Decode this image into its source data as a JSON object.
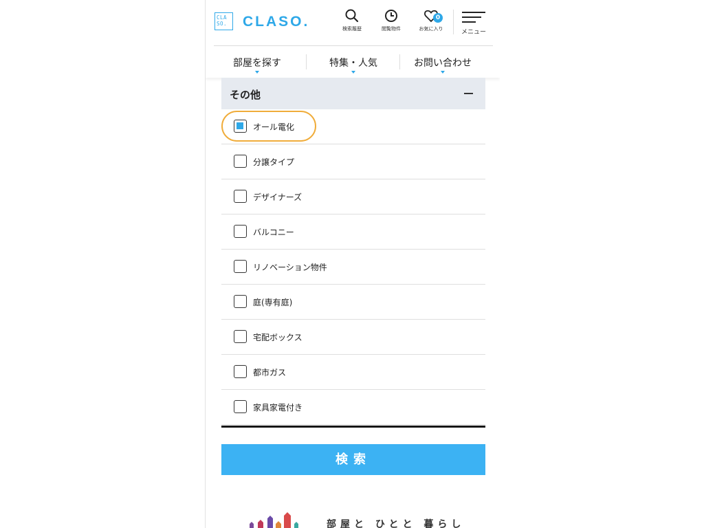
{
  "header": {
    "logo_mark_top": "CLA",
    "logo_mark_bottom": "SO.",
    "logo_text": "CLASO.",
    "icons": [
      {
        "name": "search-icon",
        "label": "検索履歴"
      },
      {
        "name": "history-icon",
        "label": "閲覧物件"
      },
      {
        "name": "heart-icon",
        "label": "お気に入り",
        "badge": "0"
      },
      {
        "name": "menu-icon",
        "label": "メニュー"
      }
    ]
  },
  "nav": {
    "items": [
      "部屋を探す",
      "特集・人気",
      "お問い合わせ"
    ]
  },
  "section": {
    "title": "その他",
    "toggle": "collapse"
  },
  "options": [
    {
      "label": "オール電化",
      "checked": true,
      "highlighted": true
    },
    {
      "label": "分譲タイプ",
      "checked": false
    },
    {
      "label": "デザイナーズ",
      "checked": false
    },
    {
      "label": "バルコニー",
      "checked": false
    },
    {
      "label": "リノベーション物件",
      "checked": false
    },
    {
      "label": "庭(専有庭)",
      "checked": false
    },
    {
      "label": "宅配ボックス",
      "checked": false
    },
    {
      "label": "都市ガス",
      "checked": false
    },
    {
      "label": "家具家電付き",
      "checked": false
    }
  ],
  "search_button": "検索",
  "footer": {
    "tagline": "部屋と ひとと 暮らし"
  },
  "colors": {
    "accent": "#2ea8e8",
    "button": "#3cb2f3",
    "highlight_ring": "#f0ac3a",
    "section_bg": "#e6eaf0"
  }
}
